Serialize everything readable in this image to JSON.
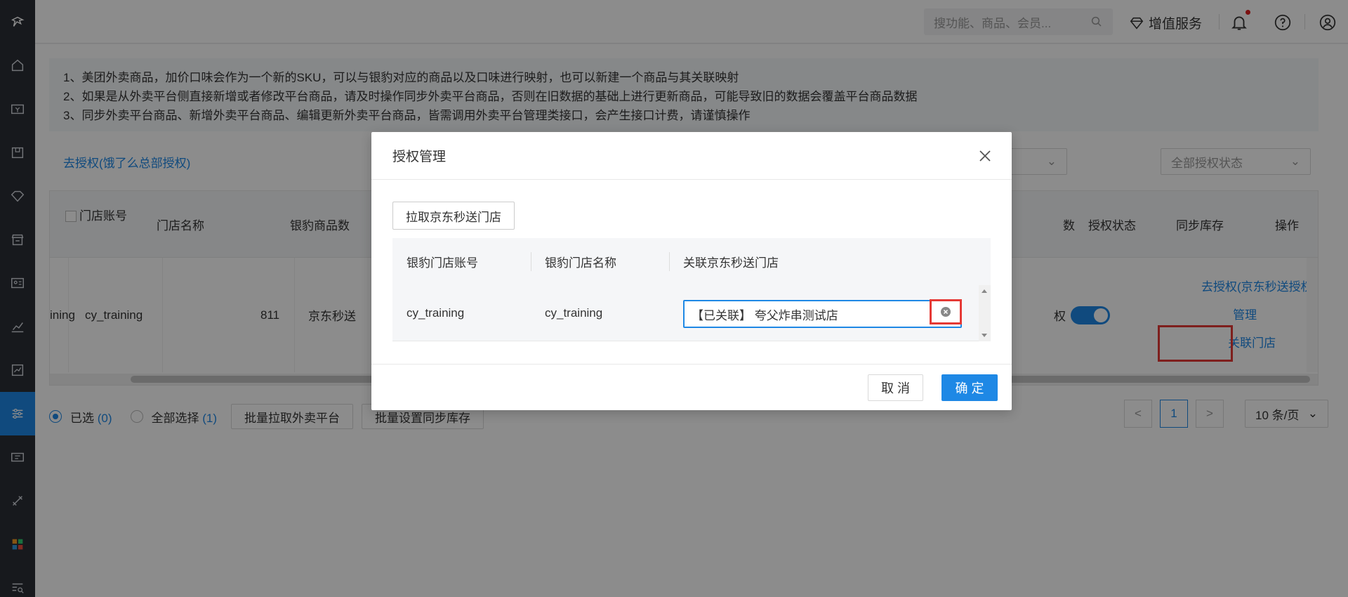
{
  "header": {
    "search_placeholder": "搜功能、商品、会员...",
    "value_added_label": "增值服务"
  },
  "sidebar": {
    "icons": [
      "logo-icon",
      "home-icon",
      "wallet-icon",
      "box-icon",
      "diamond-icon",
      "shop-icon",
      "id-card-icon",
      "chart-icon",
      "report-icon",
      "settings-icon",
      "ticket-icon",
      "tools-icon",
      "apps-icon",
      "search-list-icon"
    ]
  },
  "notice": {
    "lines": [
      "1、美团外卖商品，加价口味会作为一个新的SKU，可以与银豹对应的商品以及口味进行映射，也可以新建一个商品与其关联映射",
      "2、如果是从外卖平台侧直接新增或者修改平台商品，请及时操作同步外卖平台商品，否则在旧数据的基础上进行更新商品，可能导致旧的数据会覆盖平台商品数据",
      "3、同步外卖平台商品、新增外卖平台商品、编辑更新外卖平台商品，皆需调用外卖平台管理类接口，会产生接口计费，请谨慎操作"
    ]
  },
  "toolbar": {
    "auth_link": "去授权(饿了么总部授权)",
    "auth_status_filter": "全部授权状态"
  },
  "table": {
    "headers": {
      "account": "门店账号",
      "name": "门店名称",
      "goods_count": "银豹商品数",
      "platform_count_tail": "数",
      "auth_status": "授权状态",
      "sync_stock": "同步库存",
      "ops": "操作"
    },
    "row": {
      "account": "ining",
      "name": "cy_training",
      "goods_count": "811",
      "platform": "京东秒送",
      "auth_tail": "权",
      "op_deauth": "去授权(京东秒送授权)",
      "op_manage": "管理",
      "op_link_store": "关联门店"
    }
  },
  "footer": {
    "selected_label": "已选",
    "selected_count": "(0)",
    "select_all_label": "全部选择",
    "select_all_count": "(1)",
    "batch_pull": "批量拉取外卖平台",
    "batch_stock": "批量设置同步库存",
    "page_prev": "<",
    "page_current": "1",
    "page_next": ">",
    "page_size": "10 条/页"
  },
  "modal": {
    "title": "授权管理",
    "pull_button": "拉取京东秒送门店",
    "columns": {
      "account": "银豹门店账号",
      "name": "银豹门店名称",
      "linked": "关联京东秒送门店"
    },
    "row": {
      "account": "cy_training",
      "name": "cy_training",
      "linked_value": "【已关联】 夸父炸串测试店"
    },
    "cancel": "取 消",
    "confirm": "确 定"
  }
}
